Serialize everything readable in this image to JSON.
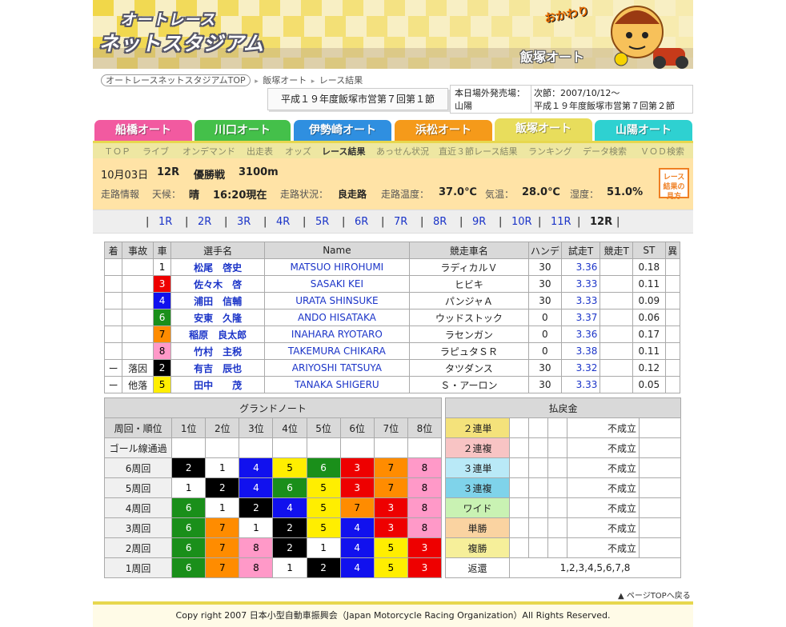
{
  "header": {
    "logo_line1": "オートレース",
    "logo_line2": "ネットスタジアム",
    "venue_banner": "飯塚オート",
    "mascot_label": "おかわり"
  },
  "breadcrumb": {
    "home": "オートレースネットスタジアムTOP",
    "venue": "飯塚オート",
    "page": "レース結果"
  },
  "meet_title": "平成１９年度飯塚市営第７回第１節",
  "offsite": {
    "label": "本日場外発売場：",
    "venue": "山陽",
    "next_label": "次節：2007/10/12〜",
    "next_meet": "平成１９年度飯塚市営第７回第２節"
  },
  "venue_tabs": [
    {
      "label": "船橋オート",
      "color": "#f25aa0"
    },
    {
      "label": "川口オート",
      "color": "#44c04a"
    },
    {
      "label": "伊勢崎オート",
      "color": "#2f8fe0"
    },
    {
      "label": "浜松オート",
      "color": "#f59a1a"
    },
    {
      "label": "飯塚オート",
      "color": "#e8dd5c"
    },
    {
      "label": "山陽オート",
      "color": "#2ed1d1"
    }
  ],
  "subnav": [
    "ＴＯＰ",
    "ライブ",
    "オンデマンド",
    "出走表",
    "オッズ",
    "レース結果",
    "あっせん状況",
    "直近３節レース結果",
    "ランキング",
    "データ検索",
    "ＶＯＤ検索"
  ],
  "race": {
    "date": "10月03日",
    "number": "12R",
    "name": "優勝戦",
    "distance": "3100m",
    "track_label": "走路情報",
    "weather_label": "天候：",
    "weather": "晴",
    "time": "16:20現在",
    "surface_label": "走路状況：",
    "surface": "良走路",
    "track_temp_label": "走路温度：",
    "track_temp": "37.0℃",
    "air_temp_label": "気温：",
    "air_temp": "28.0℃",
    "humidity_label": "湿度：",
    "humidity": "51.0%",
    "guide_button": "レース結果の見方"
  },
  "race_numbers": [
    "1R",
    "2R",
    "3R",
    "4R",
    "5R",
    "6R",
    "7R",
    "8R",
    "9R",
    "10R",
    "11R",
    "12R"
  ],
  "results": {
    "headers": [
      "着",
      "事故",
      "車",
      "選手名",
      "Name",
      "競走車名",
      "ハンデ",
      "試走T",
      "競走T",
      "ST",
      "異"
    ],
    "rows": [
      {
        "place": "",
        "incident": "",
        "car": "1",
        "name": "松尾　啓史",
        "name_en": "MATSUO HIROHUMI",
        "bike": "ラディカルＶ",
        "handicap": "30",
        "trial": "3.36",
        "race_time": "",
        "st": "0.18",
        "other": ""
      },
      {
        "place": "",
        "incident": "",
        "car": "3",
        "name": "佐々木　啓",
        "name_en": "SASAKI KEI",
        "bike": "ヒビキ",
        "handicap": "30",
        "trial": "3.33",
        "race_time": "",
        "st": "0.11",
        "other": ""
      },
      {
        "place": "",
        "incident": "",
        "car": "4",
        "name": "浦田　信輔",
        "name_en": "URATA SHINSUKE",
        "bike": "パンジャＡ",
        "handicap": "30",
        "trial": "3.33",
        "race_time": "",
        "st": "0.09",
        "other": ""
      },
      {
        "place": "",
        "incident": "",
        "car": "6",
        "name": "安東　久隆",
        "name_en": "ANDO HISATAKA",
        "bike": "ウッドストック",
        "handicap": "0",
        "trial": "3.37",
        "race_time": "",
        "st": "0.06",
        "other": ""
      },
      {
        "place": "",
        "incident": "",
        "car": "7",
        "name": "稲原　良太郎",
        "name_en": "INAHARA RYOTARO",
        "bike": "ラセンガン",
        "handicap": "0",
        "trial": "3.36",
        "race_time": "",
        "st": "0.17",
        "other": ""
      },
      {
        "place": "",
        "incident": "",
        "car": "8",
        "name": "竹村　主税",
        "name_en": "TAKEMURA CHIKARA",
        "bike": "ラピュタＳＲ",
        "handicap": "0",
        "trial": "3.38",
        "race_time": "",
        "st": "0.11",
        "other": ""
      },
      {
        "place": "ー",
        "incident": "落因",
        "car": "2",
        "name": "有吉　辰也",
        "name_en": "ARIYOSHI TATSUYA",
        "bike": "タツダンス",
        "handicap": "30",
        "trial": "3.32",
        "race_time": "",
        "st": "0.12",
        "other": ""
      },
      {
        "place": "ー",
        "incident": "他落",
        "car": "5",
        "name": "田中　　茂",
        "name_en": "TANAKA SHIGERU",
        "bike": "Ｓ・アーロン",
        "handicap": "30",
        "trial": "3.33",
        "race_time": "",
        "st": "0.05",
        "other": ""
      }
    ]
  },
  "grid_note": {
    "title": "グランドノート",
    "corner": "周回・順位",
    "positions": [
      "1位",
      "2位",
      "3位",
      "4位",
      "5位",
      "6位",
      "7位",
      "8位"
    ],
    "rows": [
      {
        "label": "ゴール線通過",
        "cars": [
          "",
          "",
          "",
          "",
          "",
          "",
          "",
          ""
        ]
      },
      {
        "label": "6周回",
        "cars": [
          "2",
          "1",
          "4",
          "5",
          "6",
          "3",
          "7",
          "8"
        ]
      },
      {
        "label": "5周回",
        "cars": [
          "1",
          "2",
          "4",
          "6",
          "5",
          "3",
          "7",
          "8"
        ]
      },
      {
        "label": "4周回",
        "cars": [
          "6",
          "1",
          "2",
          "4",
          "5",
          "7",
          "3",
          "8"
        ]
      },
      {
        "label": "3周回",
        "cars": [
          "6",
          "7",
          "1",
          "2",
          "5",
          "4",
          "3",
          "8"
        ]
      },
      {
        "label": "2周回",
        "cars": [
          "6",
          "7",
          "8",
          "2",
          "1",
          "4",
          "5",
          "3"
        ]
      },
      {
        "label": "1周回",
        "cars": [
          "6",
          "7",
          "8",
          "1",
          "2",
          "4",
          "5",
          "3"
        ]
      }
    ]
  },
  "payout": {
    "title": "払戻金",
    "rows": [
      {
        "label": "２連単",
        "color": "#f4e27b",
        "value": "不成立"
      },
      {
        "label": "２連複",
        "color": "#f8c4c4",
        "value": "不成立"
      },
      {
        "label": "３連単",
        "color": "#b9e9f7",
        "value": "不成立"
      },
      {
        "label": "３連複",
        "color": "#7fd3ea",
        "value": "不成立"
      },
      {
        "label": "ワイド",
        "color": "#c9f2b3",
        "value": "不成立"
      },
      {
        "label": "単勝",
        "color": "#fad3a1",
        "value": "不成立"
      },
      {
        "label": "複勝",
        "color": "#f6ef9a",
        "value": "不成立"
      }
    ],
    "refund_label": "返還",
    "refund_value": "1,2,3,4,5,6,7,8"
  },
  "page_top": "ページTOPへ戻る",
  "footer": "Copy right 2007 日本小型自動車振興会（Japan Motorcycle Racing Organization）All Rights Reserved."
}
